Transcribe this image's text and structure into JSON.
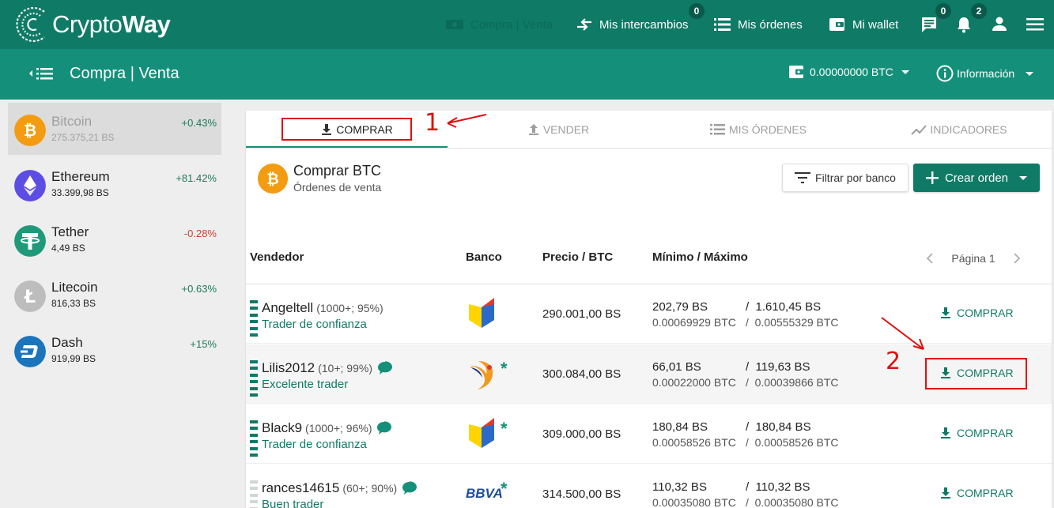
{
  "brand": {
    "name_light": "Crypto",
    "name_bold": "Way"
  },
  "topnav": {
    "compra_venta": "Compra | Venta",
    "intercambios": "Mis intercambios",
    "intercambios_badge": "0",
    "ordenes": "Mis órdenes",
    "wallet": "Mi wallet",
    "messages_badge": "0",
    "notifications_badge": "2"
  },
  "subbar": {
    "title": "Compra | Venta",
    "balance": "0.00000000 BTC",
    "info": "Información"
  },
  "sidebar": {
    "coins": [
      {
        "name": "Bitcoin",
        "price": "275.375,21 BS",
        "change": "+0.43%",
        "color": "#f39c12"
      },
      {
        "name": "Ethereum",
        "price": "33.399,98 BS",
        "change": "+81.42%",
        "color": "#5c4ee5"
      },
      {
        "name": "Tether",
        "price": "4,49 BS",
        "change": "-0.28%",
        "color": "#1e9a7a"
      },
      {
        "name": "Litecoin",
        "price": "816,33 BS",
        "change": "+0.63%",
        "color": "#bdbdbd"
      },
      {
        "name": "Dash",
        "price": "919,99 BS",
        "change": "+15%",
        "color": "#1c75bc"
      }
    ]
  },
  "tabs": [
    "COMPRAR",
    "VENDER",
    "MIS ÓRDENES",
    "INDICADORES"
  ],
  "header": {
    "title": "Comprar BTC",
    "subtitle": "Órdenes de venta",
    "filter_btn": "Filtrar por banco",
    "create_btn": "Crear orden"
  },
  "table": {
    "columns": [
      "Vendedor",
      "Banco",
      "Precio / BTC",
      "Mínimo / Máximo"
    ],
    "page": "Página 1",
    "rows": [
      {
        "seller": "Angeltell",
        "meta": "(1000+; 95%)",
        "tag": "Trader de confianza",
        "price": "290.001,00 BS",
        "min_bs": "202,79 BS",
        "min_btc": "0.00069929 BTC",
        "max_bs": "1.610,45 BS",
        "max_btc": "0.00555329 BTC",
        "action": "COMPRAR",
        "bank": "bod",
        "star": false,
        "chat": false
      },
      {
        "seller": "Lilis2012",
        "meta": "(10+; 99%)",
        "tag": "Excelente trader",
        "price": "300.084,00 BS",
        "min_bs": "66,01 BS",
        "min_btc": "0.00022000 BTC",
        "max_bs": "119,63 BS",
        "max_btc": "0.00039866 BTC",
        "action": "COMPRAR",
        "bank": "venezuela",
        "star": true,
        "chat": true
      },
      {
        "seller": "Black9",
        "meta": "(1000+; 96%)",
        "tag": "Trader de confianza",
        "price": "309.000,00 BS",
        "min_bs": "180,84 BS",
        "min_btc": "0.00058526 BTC",
        "max_bs": "180,84 BS",
        "max_btc": "0.00058526 BTC",
        "action": "COMPRAR",
        "bank": "bod",
        "star": true,
        "chat": true
      },
      {
        "seller": "rances14615",
        "meta": "(60+; 90%)",
        "tag": "Buen trader",
        "price": "314.500,00 BS",
        "min_bs": "110,32 BS",
        "min_btc": "0.00035080 BTC",
        "max_bs": "110,32 BS",
        "max_btc": "0.00035080 BTC",
        "action": "COMPRAR",
        "bank": "BBVA",
        "star": true,
        "chat": true
      }
    ]
  },
  "annotations": {
    "one": "1",
    "two": "2"
  },
  "colors": {
    "primary": "#0f7a66",
    "secondary": "#14907a",
    "annotation": "#e01010"
  }
}
